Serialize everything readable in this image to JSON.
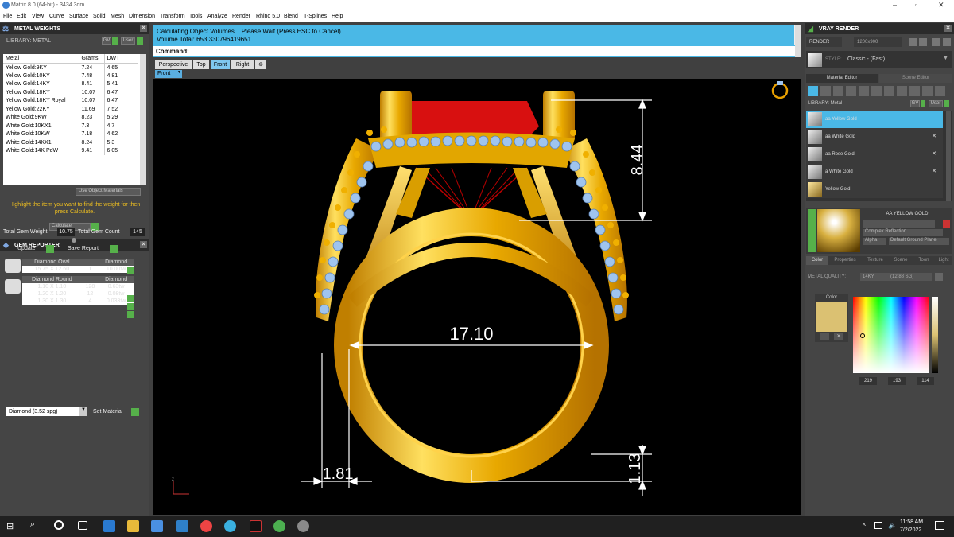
{
  "window": {
    "title": "Matrix 8.0 (64-bit) - 3434.3dm"
  },
  "menu": [
    "File",
    "Edit",
    "View",
    "Curve",
    "Surface",
    "Solid",
    "Mesh",
    "Dimension",
    "Transform",
    "Tools",
    "Analyze",
    "Render",
    "Rhino 5.0",
    "Blend",
    "T-Splines",
    "Help"
  ],
  "metal_weights": {
    "title": "METAL WEIGHTS",
    "library_label": "LIBRARY: METAL",
    "gv": "GV",
    "user": "User",
    "columns": [
      "Metal",
      "Grams",
      "DWT"
    ],
    "rows": [
      [
        "Yellow Gold:9KY",
        "7.24",
        "4.65"
      ],
      [
        "Yellow Gold:10KY",
        "7.48",
        "4.81"
      ],
      [
        "Yellow Gold:14KY",
        "8.41",
        "5.41"
      ],
      [
        "Yellow Gold:18KY",
        "10.07",
        "6.47"
      ],
      [
        "Yellow Gold:18KY Royal",
        "10.07",
        "6.47"
      ],
      [
        "Yellow Gold:22KY",
        "11.69",
        "7.52"
      ],
      [
        "White Gold:9KW",
        "8.23",
        "5.29"
      ],
      [
        "White Gold:10KX1",
        "7.3",
        "4.7"
      ],
      [
        "White Gold:10KW",
        "7.18",
        "4.62"
      ],
      [
        "White Gold:14KX1",
        "8.24",
        "5.3"
      ],
      [
        "White Gold:14K PdW",
        "9.41",
        "6.05"
      ]
    ],
    "use_object_materials": "Use Object Materials",
    "hint": "Highlight the item you want to find the weight for then press Calculate.",
    "calculate": "Calculate"
  },
  "gem_reporter": {
    "title": "GEM REPORTER",
    "total_weight_label": "Total Gem Weight",
    "total_weight": "10.75",
    "total_count_label": "Total Gem Count",
    "total_count": "145",
    "update": "Update",
    "save_report": "Save Report",
    "groups": [
      {
        "shape": "Diamond Oval",
        "material": "Diamond",
        "rows": [
          [
            "15.75 X 12.60",
            "1",
            "10.00tw"
          ]
        ]
      },
      {
        "shape": "Diamond Round",
        "material": "Diamond",
        "rows": [
          [
            "1.10 X 1.10",
            "128",
            "0.63tw"
          ],
          [
            "1.20 X 1.20",
            "12",
            "0.08tw"
          ],
          [
            "1.30 X 1.30",
            "4",
            "0.033tw"
          ]
        ]
      }
    ],
    "material_select": "Diamond    (3.52 spg)",
    "set_material": "Set Material"
  },
  "command": {
    "line1": "Calculating Object Volumes... Please Wait (Press ESC to Cancel)",
    "line2": "Volume Total: 653.330796419651",
    "label": "Command:"
  },
  "tabs": [
    "Perspective",
    "Top",
    "Front",
    "Right"
  ],
  "active_tab": "Front",
  "view_label": "Front",
  "dimensions": {
    "height": "8.44",
    "width": "17.10",
    "shank": "1.81",
    "bottom": "1.13"
  },
  "vray": {
    "title": "VRAY RENDER",
    "render": "RENDER",
    "resolution": "1200x900",
    "style_label": "STYLE:",
    "style_value": "Classic - (Fast)",
    "tab_material": "Material Editor",
    "tab_scene": "Scene Editor",
    "library_label": "LIBRARY: Metal",
    "gv": "GV",
    "user": "User",
    "materials": [
      "aa Yellow Gold",
      "aa White Gold",
      "aa Rose Gold",
      "a White Gold",
      "Yellow Gold"
    ],
    "selected_name": "AA YELLOW GOLD",
    "reflection": "Complex Reflection",
    "alpha_label": "Alpha",
    "ground": "Default Ground Plane",
    "subtabs": [
      "Color",
      "Properties",
      "Texture",
      "Scene",
      "Toon",
      "Light"
    ],
    "metal_quality_label": "METAL QUALITY:",
    "metal_quality": "14KY",
    "metal_quality_sg": "(12.88 SG)",
    "color_label": "Color",
    "rgb": [
      "219",
      "193",
      "114"
    ],
    "swatch": "#dbc172"
  },
  "taskbar": {
    "time": "11:58 AM",
    "date": "7/2/2022"
  },
  "colors": {
    "accent": "#4ab8e6",
    "gold": "#e8b000",
    "gem": "#d81010",
    "dim": "#ffffff"
  }
}
